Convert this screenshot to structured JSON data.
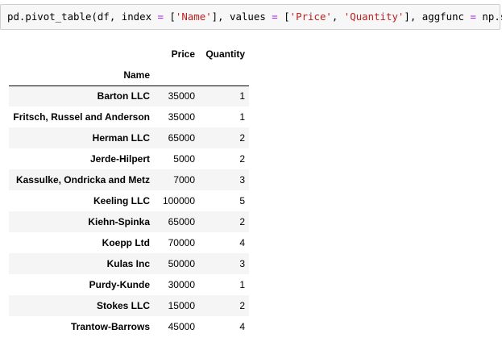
{
  "code_cell": {
    "tokens": [
      {
        "t": "pd.pivot_table(df, index ",
        "k": "plain"
      },
      {
        "t": "=",
        "k": "op"
      },
      {
        "t": " [",
        "k": "plain"
      },
      {
        "t": "'Name'",
        "k": "str"
      },
      {
        "t": "], values ",
        "k": "plain"
      },
      {
        "t": "=",
        "k": "op"
      },
      {
        "t": " [",
        "k": "plain"
      },
      {
        "t": "'Price'",
        "k": "str"
      },
      {
        "t": ", ",
        "k": "plain"
      },
      {
        "t": "'Quantity'",
        "k": "str"
      },
      {
        "t": "], aggfunc ",
        "k": "plain"
      },
      {
        "t": "=",
        "k": "op"
      },
      {
        "t": " np.sum)",
        "k": "plain"
      }
    ]
  },
  "table": {
    "columns": [
      "Price",
      "Quantity"
    ],
    "index_name": "Name",
    "rows": [
      {
        "name": "Barton LLC",
        "price": "35000",
        "quantity": "1"
      },
      {
        "name": "Fritsch, Russel and Anderson",
        "price": "35000",
        "quantity": "1"
      },
      {
        "name": "Herman LLC",
        "price": "65000",
        "quantity": "2"
      },
      {
        "name": "Jerde-Hilpert",
        "price": "5000",
        "quantity": "2"
      },
      {
        "name": "Kassulke, Ondricka and Metz",
        "price": "7000",
        "quantity": "3"
      },
      {
        "name": "Keeling LLC",
        "price": "100000",
        "quantity": "5"
      },
      {
        "name": "Kiehn-Spinka",
        "price": "65000",
        "quantity": "2"
      },
      {
        "name": "Koepp Ltd",
        "price": "70000",
        "quantity": "4"
      },
      {
        "name": "Kulas Inc",
        "price": "50000",
        "quantity": "3"
      },
      {
        "name": "Purdy-Kunde",
        "price": "30000",
        "quantity": "1"
      },
      {
        "name": "Stokes LLC",
        "price": "15000",
        "quantity": "2"
      },
      {
        "name": "Trantow-Barrows",
        "price": "45000",
        "quantity": "4"
      }
    ]
  },
  "colors": {
    "string": "#ba2121",
    "operator": "#aa22ff",
    "stripe": "#f5f5f5",
    "cell_bg": "#f7f7f7",
    "cell_border": "#cfcfcf"
  }
}
